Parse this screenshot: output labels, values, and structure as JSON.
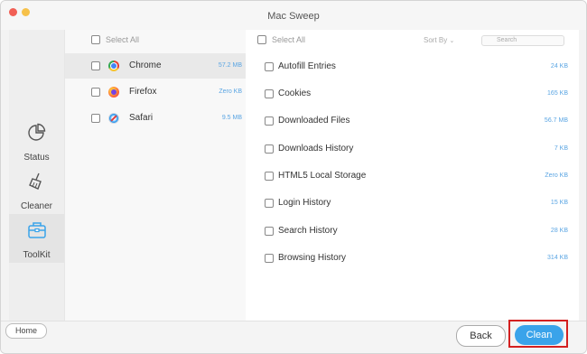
{
  "app": {
    "title": "Mac Sweep"
  },
  "sidebar": {
    "items": [
      {
        "label": "Status",
        "icon": "pie-chart-icon",
        "active": false
      },
      {
        "label": "Cleaner",
        "icon": "broom-icon",
        "active": false
      },
      {
        "label": "ToolKit",
        "icon": "toolbox-icon",
        "active": true
      }
    ],
    "home_label": "Home"
  },
  "browsers": {
    "select_all_label": "Select All",
    "items": [
      {
        "name": "Chrome",
        "size": "57.2 MB",
        "icon": "chrome-icon",
        "selected": true
      },
      {
        "name": "Firefox",
        "size": "Zero KB",
        "icon": "firefox-icon",
        "selected": false
      },
      {
        "name": "Safari",
        "size": "9.5 MB",
        "icon": "safari-icon",
        "selected": false
      }
    ]
  },
  "details": {
    "select_all_label": "Select All",
    "sort_label": "Sort By",
    "search_placeholder": "Search",
    "items": [
      {
        "name": "Autofill Entries",
        "size": "24 KB"
      },
      {
        "name": "Cookies",
        "size": "165 KB"
      },
      {
        "name": "Downloaded Files",
        "size": "56.7 MB"
      },
      {
        "name": "Downloads History",
        "size": "7 KB"
      },
      {
        "name": "HTML5 Local Storage",
        "size": "Zero KB"
      },
      {
        "name": "Login History",
        "size": "15 KB"
      },
      {
        "name": "Search History",
        "size": "28 KB"
      },
      {
        "name": "Browsing History",
        "size": "314 KB"
      }
    ]
  },
  "actions": {
    "back_label": "Back",
    "clean_label": "Clean"
  },
  "colors": {
    "accent": "#3aa3ea",
    "size_text": "#5aa5e3",
    "highlight": "#d42020"
  }
}
